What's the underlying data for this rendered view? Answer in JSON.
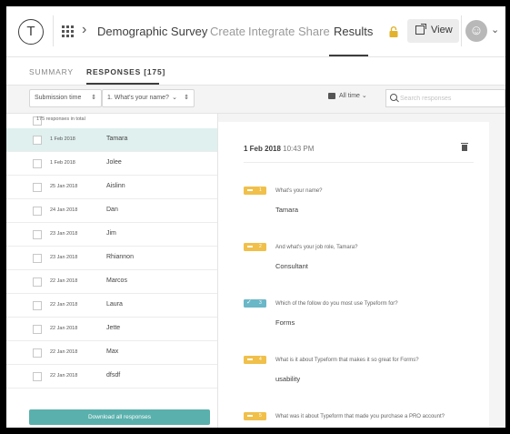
{
  "colors": {
    "accent_teal": "#5ab0ac",
    "badge_yellow": "#f0c04a",
    "badge_teal": "#6ab7c7",
    "selected_row": "#dff0ee",
    "lock_yellow": "#e2b22c"
  },
  "header": {
    "logo_letter": "T",
    "breadcrumb_arrow": "›",
    "form_title": "Demographic Survey",
    "nav": [
      "Create",
      "Integrate",
      "Share",
      "Results"
    ],
    "active_nav": "Results",
    "view_label": "View",
    "avatar_glyph": "☺",
    "avatar_caret": "⌄"
  },
  "subtabs": {
    "summary": "SUMMARY",
    "responses": "RESPONSES [175]"
  },
  "filters": {
    "sort_label": "Submission time",
    "sort_caret": "⇕",
    "question_label": "1. What's your name?",
    "question_caret": "⌄",
    "question_caret2": "⇕",
    "time_label": "All time ⌄",
    "search_placeholder": "Search responses"
  },
  "list": {
    "count_text": "175 responses in total",
    "rows": [
      {
        "date": "1 Feb 2018",
        "name": "Tamara",
        "selected": true
      },
      {
        "date": "1 Feb 2018",
        "name": "Jolee"
      },
      {
        "date": "25 Jan 2018",
        "name": "Aislinn"
      },
      {
        "date": "24 Jan 2018",
        "name": "Dan"
      },
      {
        "date": "23 Jan 2018",
        "name": "Jim"
      },
      {
        "date": "23 Jan 2018",
        "name": "Rhiannon"
      },
      {
        "date": "22 Jan 2018",
        "name": "Marcos"
      },
      {
        "date": "22 Jan 2018",
        "name": "Laura"
      },
      {
        "date": "22 Jan 2018",
        "name": "Jette"
      },
      {
        "date": "22 Jan 2018",
        "name": "Max"
      },
      {
        "date": "22 Jan 2018",
        "name": "dfsdf"
      }
    ],
    "download_label": "Download all responses"
  },
  "detail": {
    "date": "1 Feb 2018",
    "time": "10:43 PM",
    "qas": [
      {
        "num": "1",
        "type": "text",
        "question": "What's your name?",
        "answer": "Tamara"
      },
      {
        "num": "2",
        "type": "text",
        "question": "And what's your job role, Tamara?",
        "answer": "Consultant"
      },
      {
        "num": "3",
        "type": "choice",
        "question": "Which of the follow do you most use Typeform for?",
        "answer": "Forms"
      },
      {
        "num": "4",
        "type": "text",
        "question": "What is it about Typeform that makes it so great for Forms?",
        "answer": "usability"
      },
      {
        "num": "5",
        "type": "text",
        "question": "What was it about Typeform that made you purchase a PRO account?",
        "answer": ""
      }
    ]
  }
}
